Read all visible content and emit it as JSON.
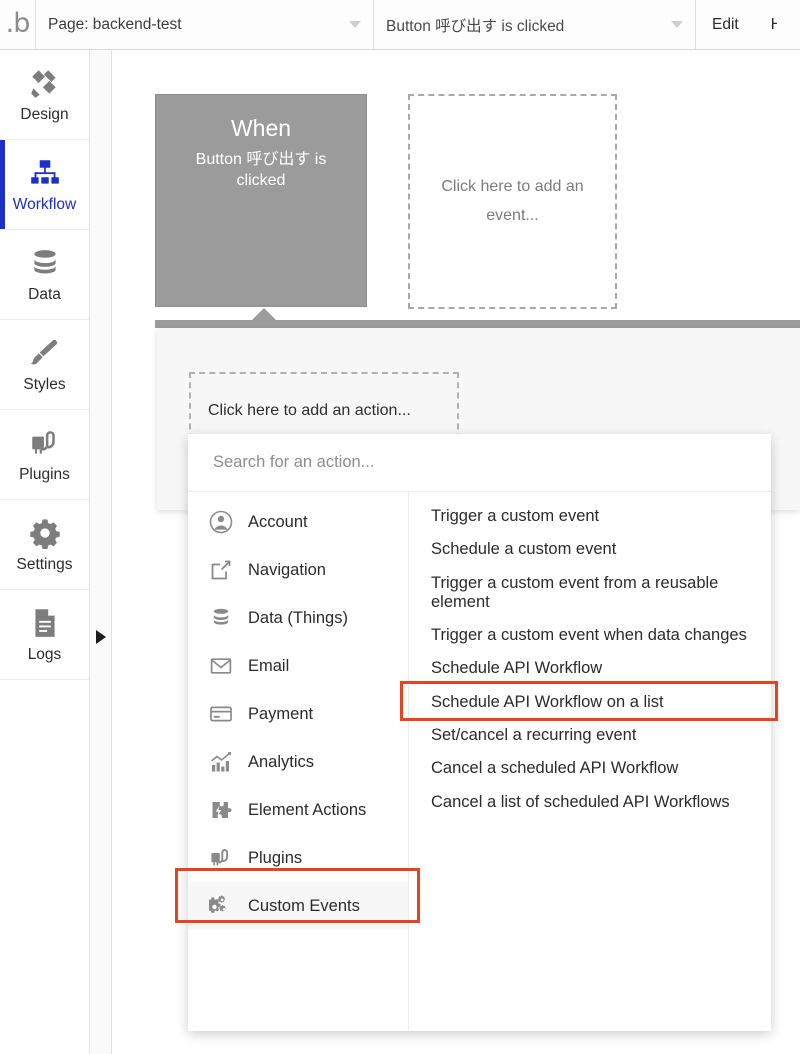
{
  "header": {
    "logo": "bubble-logo",
    "page_selector": {
      "value": "Page: backend-test",
      "caret": "chevron-down-icon"
    },
    "event_selector": {
      "value": "Button 呼び出す is clicked",
      "caret": "chevron-down-icon"
    },
    "edit_button": "Edit",
    "next_button": "H"
  },
  "sidebar": {
    "items": [
      {
        "label": "Design",
        "icon": "design-icon",
        "active": false
      },
      {
        "label": "Workflow",
        "icon": "workflow-icon",
        "active": true
      },
      {
        "label": "Data",
        "icon": "data-icon",
        "active": false
      },
      {
        "label": "Styles",
        "icon": "styles-icon",
        "active": false
      },
      {
        "label": "Plugins",
        "icon": "plugins-icon",
        "active": false
      },
      {
        "label": "Settings",
        "icon": "settings-icon",
        "active": false
      },
      {
        "label": "Logs",
        "icon": "logs-icon",
        "active": false
      }
    ],
    "collapse_arrow": "expand-right-arrow-icon"
  },
  "canvas": {
    "when_box": {
      "title": "When",
      "subtitle": "Button 呼び出す is clicked"
    },
    "add_event_box": {
      "text": "Click here to add an event..."
    },
    "action_panel": {
      "add_action_text": "Click here to add an action..."
    }
  },
  "dropdown": {
    "search": {
      "value": "",
      "placeholder": "Search for an action..."
    },
    "categories": [
      {
        "label": "Account",
        "icon": "account-icon",
        "selected": false
      },
      {
        "label": "Navigation",
        "icon": "navigation-icon",
        "selected": false
      },
      {
        "label": "Data (Things)",
        "icon": "database-icon",
        "selected": false
      },
      {
        "label": "Email",
        "icon": "email-icon",
        "selected": false
      },
      {
        "label": "Payment",
        "icon": "payment-card-icon",
        "selected": false
      },
      {
        "label": "Analytics",
        "icon": "analytics-chart-icon",
        "selected": false
      },
      {
        "label": "Element Actions",
        "icon": "puzzle-bolt-icon",
        "selected": false
      },
      {
        "label": "Plugins",
        "icon": "plugins-icon",
        "selected": false
      },
      {
        "label": "Custom Events",
        "icon": "gears-icon",
        "selected": true
      }
    ],
    "actions": [
      {
        "label": "Trigger a custom event"
      },
      {
        "label": "Schedule a custom event"
      },
      {
        "label": "Trigger a custom event from a reusable element"
      },
      {
        "label": "Trigger a custom event when data changes"
      },
      {
        "label": "Schedule API Workflow"
      },
      {
        "label": "Schedule API Workflow on a list"
      },
      {
        "label": "Set/cancel a recurring event"
      },
      {
        "label": "Cancel a scheduled API Workflow"
      },
      {
        "label": "Cancel a list of scheduled API Workflows"
      }
    ]
  },
  "annotations": {
    "highlight_color": "#e8431f",
    "boxes": [
      {
        "target": "Schedule API Workflow"
      },
      {
        "target": "Custom Events"
      }
    ]
  },
  "colors": {
    "accent_blue": "#1c2fc7",
    "when_box_gray": "#9b9b9b",
    "highlight_red": "#e8431f"
  }
}
